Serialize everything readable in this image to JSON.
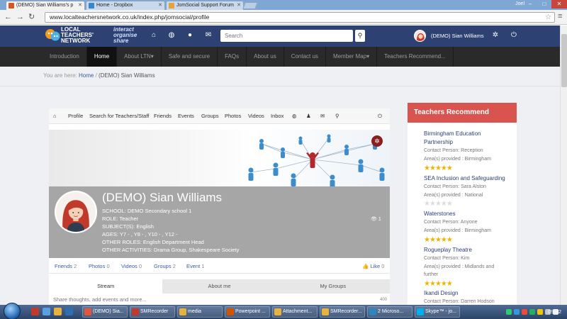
{
  "browser": {
    "tabs": [
      {
        "label": "(DEMO) Sian Williams's p",
        "favicon": "#d4572a"
      },
      {
        "label": "Home - Dropbox",
        "favicon": "#3a85d0"
      },
      {
        "label": "JomSocial Support Forum",
        "favicon": "#e6a23c"
      }
    ],
    "window_user": "Joel",
    "url": "www.localteachersnetwork.co.uk/index.php/jomsocial/profile"
  },
  "site": {
    "logo_line1": "LOCAL",
    "logo_line2": "TEACHERS'",
    "logo_line3": "NETWORK",
    "tag_line1": "interact",
    "tag_line2": "organise",
    "tag_line3": "share",
    "search_placeholder": "Search",
    "user_name": "(DEMO) Sian Williams",
    "brand_color": "#2d4173"
  },
  "nav": {
    "items": [
      "Introduction",
      "Home",
      "About LTN▾",
      "Safe and secure",
      "FAQs",
      "About us",
      "Contact us",
      "Member Map▾",
      "Teachers Recommend..."
    ]
  },
  "breadcrumb": {
    "prefix": "You are here:",
    "home": "Home",
    "sep": "/",
    "current": "(DEMO) Sian Williams"
  },
  "toolbar": {
    "items": [
      "Profile",
      "Search for Teachers/Staff",
      "Friends",
      "Events",
      "Groups",
      "Photos",
      "Videos",
      "Inbox"
    ]
  },
  "profile": {
    "name": "(DEMO) Sian Williams",
    "school": "SCHOOL: DEMO Secondary school 1",
    "role": "ROLE: Teacher",
    "subjects": "SUBJECT(S): English",
    "ages": "AGES: Y7 - , Y8 - , Y10 - , Y12 -",
    "other_roles": "OTHER ROLES: English Department Head",
    "other_activities": "OTHER ACTIVITIES: Drama Group, Shakespeare Society",
    "views": "1"
  },
  "stats": {
    "friends_label": "Friends",
    "friends": "2",
    "photos_label": "Photos",
    "photos": "0",
    "videos_label": "Videos",
    "videos": "0",
    "groups_label": "Groups",
    "groups": "2",
    "events_label": "Event",
    "events": "1",
    "like_label": "Like",
    "likes": "0"
  },
  "tabs": [
    "Stream",
    "About me",
    "My Groups"
  ],
  "share": {
    "placeholder": "Share thoughts, add events and more...",
    "count": "400"
  },
  "sidebar": {
    "title": "Teachers Recommend",
    "items": [
      {
        "name1": "Birmingham Education",
        "name2": "Partnership",
        "contact": "Contact Person: Reception",
        "area": "Area(s) provided : Birmingham",
        "rating": 5
      },
      {
        "name1": "SEA Inclusion and Safeguarding",
        "name2": "",
        "contact": "Contact Person: Sara Alston",
        "area": "Area(s) provided : National",
        "rating": 0
      },
      {
        "name1": "Waterstones",
        "name2": "",
        "contact": "Contact Person: Anyone",
        "area": "Area(s) provided : Birmingham",
        "rating": 5
      },
      {
        "name1": "Rogueplay Theatre",
        "name2": "",
        "contact": "Contact Person: Kim",
        "area": "Area(s) provided : Midlands and",
        "area2": "further",
        "rating": 5
      },
      {
        "name1": "Ikandi Design",
        "name2": "",
        "contact": "Contact Person: Darren Hodson",
        "area": "",
        "rating": 0
      }
    ]
  },
  "taskbar": {
    "items": [
      "(DEMO) Sia...",
      "SMRecorder",
      "media",
      "Powerpoint ...",
      "Attachment...",
      "SMRecorder...",
      "2 Microso...",
      "Skype™ - jo..."
    ],
    "clock": "09:42"
  }
}
